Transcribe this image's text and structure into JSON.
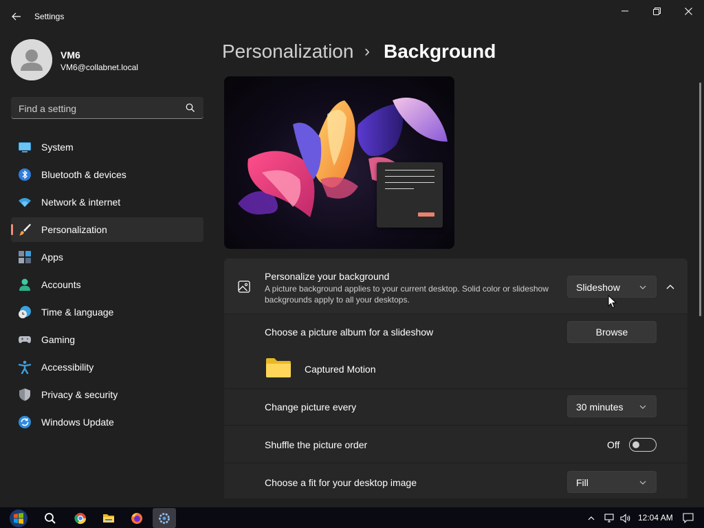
{
  "window": {
    "title": "Settings"
  },
  "profile": {
    "name": "VM6",
    "email": "VM6@collabnet.local"
  },
  "search": {
    "placeholder": "Find a setting"
  },
  "sidebar": {
    "items": [
      {
        "label": "System",
        "icon": "system-icon"
      },
      {
        "label": "Bluetooth & devices",
        "icon": "bluetooth-icon"
      },
      {
        "label": "Network & internet",
        "icon": "wifi-icon"
      },
      {
        "label": "Personalization",
        "icon": "brush-icon",
        "active": true
      },
      {
        "label": "Apps",
        "icon": "apps-icon"
      },
      {
        "label": "Accounts",
        "icon": "accounts-icon"
      },
      {
        "label": "Time & language",
        "icon": "clock-globe-icon"
      },
      {
        "label": "Gaming",
        "icon": "gamepad-icon"
      },
      {
        "label": "Accessibility",
        "icon": "accessibility-icon"
      },
      {
        "label": "Privacy & security",
        "icon": "shield-icon"
      },
      {
        "label": "Windows Update",
        "icon": "update-icon"
      }
    ]
  },
  "header": {
    "parent": "Personalization",
    "separator": "›",
    "current": "Background"
  },
  "background": {
    "title": "Personalize your background",
    "description": "A picture background applies to your current desktop. Solid color or slideshow backgrounds apply to all your desktops.",
    "type_value": "Slideshow",
    "album_label": "Choose a picture album for a slideshow",
    "browse_label": "Browse",
    "album_name": "Captured Motion",
    "interval_label": "Change picture every",
    "interval_value": "30 minutes",
    "shuffle_label": "Shuffle the picture order",
    "shuffle_state": "Off",
    "fit_label": "Choose a fit for your desktop image",
    "fit_value": "Fill"
  },
  "taskbar": {
    "time": "12:04 AM",
    "apps": [
      "start-icon",
      "search-icon",
      "chrome-icon",
      "file-explorer-icon",
      "firefox-icon",
      "settings-icon"
    ]
  },
  "colors": {
    "accent": "#f08d7a",
    "window_bg": "#202020",
    "card_bg": "#2b2b2b"
  }
}
